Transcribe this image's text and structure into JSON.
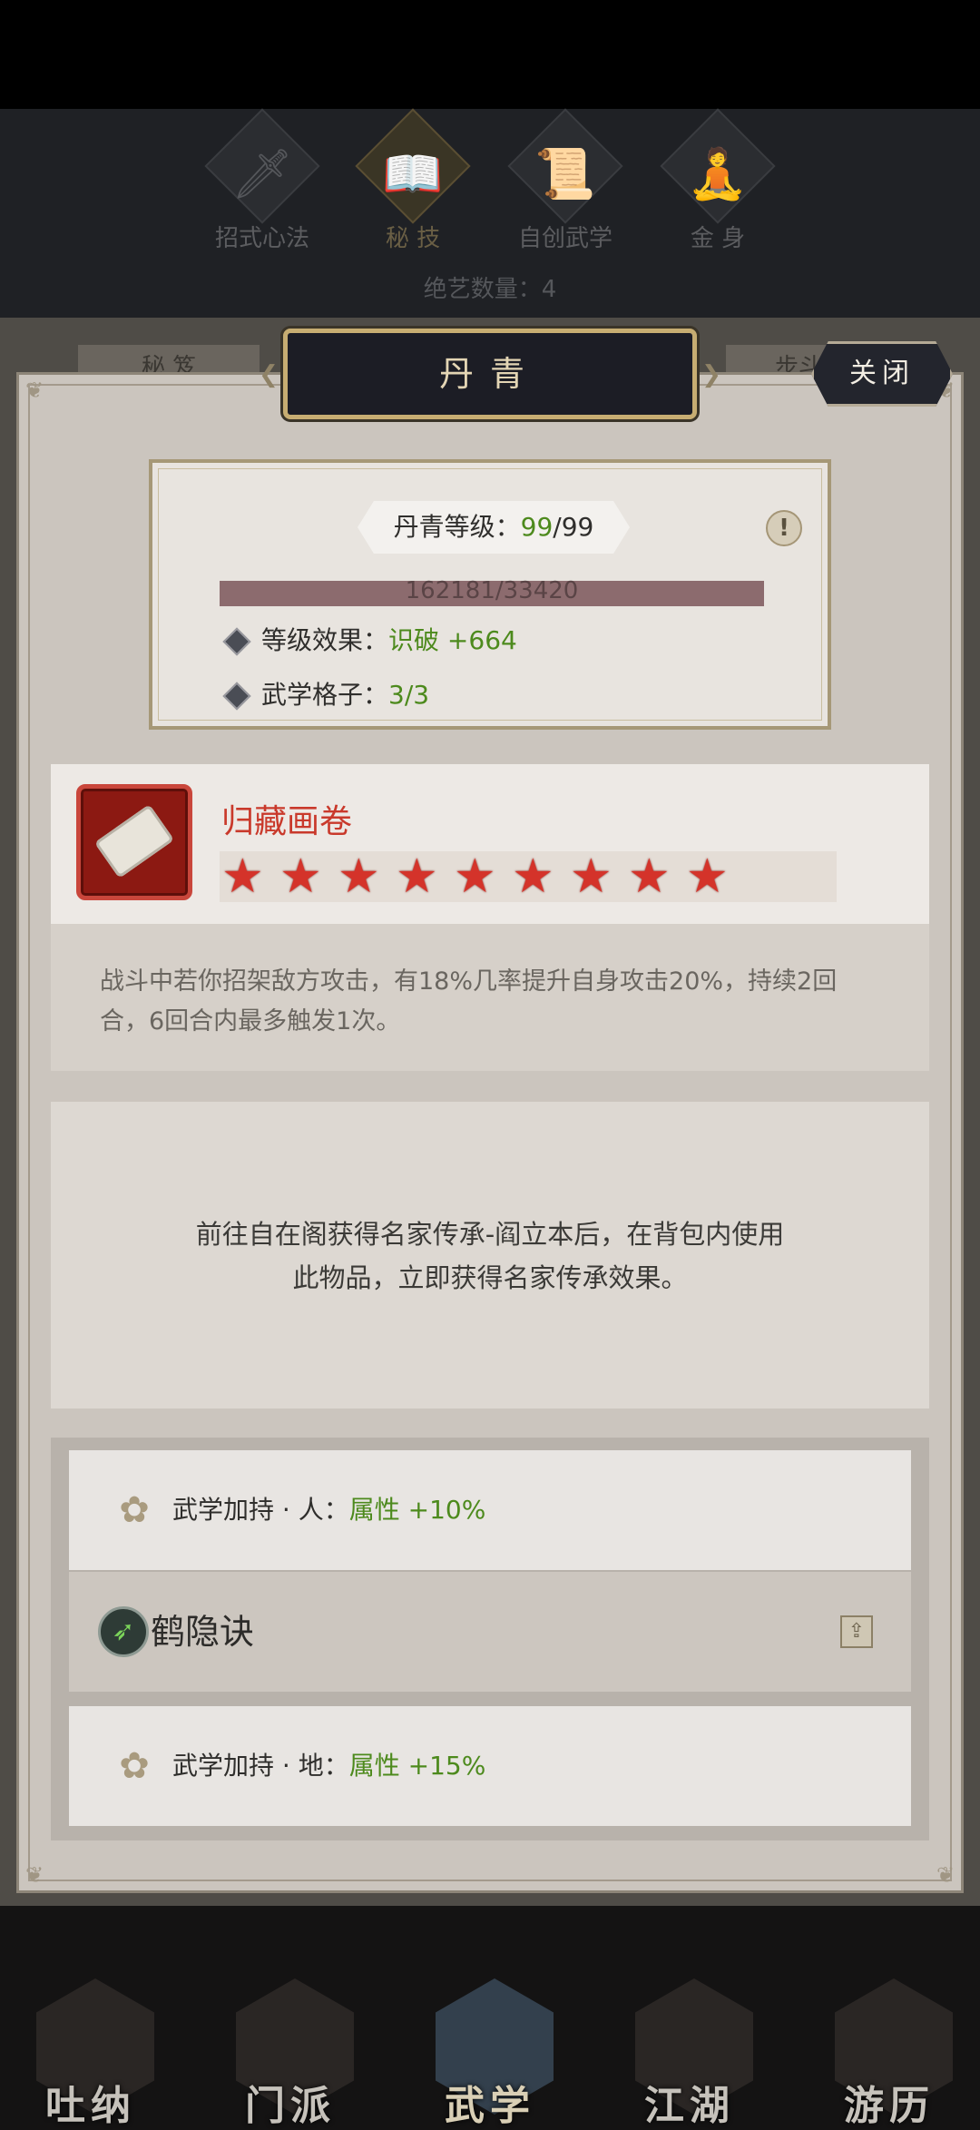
{
  "top_nav": {
    "items": [
      {
        "label": "招式心法",
        "icon": "sword-icon",
        "glyph": "🗡"
      },
      {
        "label": "秘 技",
        "icon": "book-icon",
        "glyph": "📖"
      },
      {
        "label": "自创武学",
        "icon": "scroll-icon",
        "glyph": "📜"
      },
      {
        "label": "金 身",
        "icon": "meditation-icon",
        "glyph": "🧘"
      }
    ],
    "count_line": "绝艺数量：4"
  },
  "side_tabs": {
    "left": "秘 笈",
    "right": "步斗"
  },
  "dialog": {
    "title": "丹青",
    "close_label": "关闭",
    "level": {
      "label": "丹青等级：",
      "current": "99",
      "max": "/99",
      "info_icon": "!",
      "exp_text": "162181/33420",
      "effect_label": "等级效果：",
      "effect_value": "识破 +664",
      "slots_label": "武学格子：",
      "slots_value": "3/3"
    },
    "item": {
      "name": "归藏画卷",
      "stars": 9,
      "star_glyph": "★",
      "description": "战斗中若你招架敌方攻击，有18%几率提升自身攻击20%，持续2回合，6回合内最多触发1次。"
    },
    "hint": "前往自在阁获得名家传承-阎立本后，在背包内使用此物品，立即获得名家传承效果。",
    "bonuses": [
      {
        "label": "武学加持 · 人：",
        "value": "属性 +10%",
        "icon": "✿"
      },
      {
        "label": "武学加持 · 地：",
        "value": "属性 +15%",
        "icon": "✿"
      }
    ],
    "skill": {
      "name": "鹤隐诀",
      "icon_glyph": "➶",
      "upload_glyph": "⇪"
    }
  },
  "bottom_nav": {
    "items": [
      {
        "label": "吐纳"
      },
      {
        "label": "门派"
      },
      {
        "label": "武学"
      },
      {
        "label": "江湖"
      },
      {
        "label": "游历"
      }
    ]
  },
  "colors": {
    "accent_gold": "#c7ad72",
    "title_bg": "#1c1d25",
    "value_green": "#4d8a1d",
    "item_red": "#c9392b",
    "star_red": "#d4332a"
  }
}
